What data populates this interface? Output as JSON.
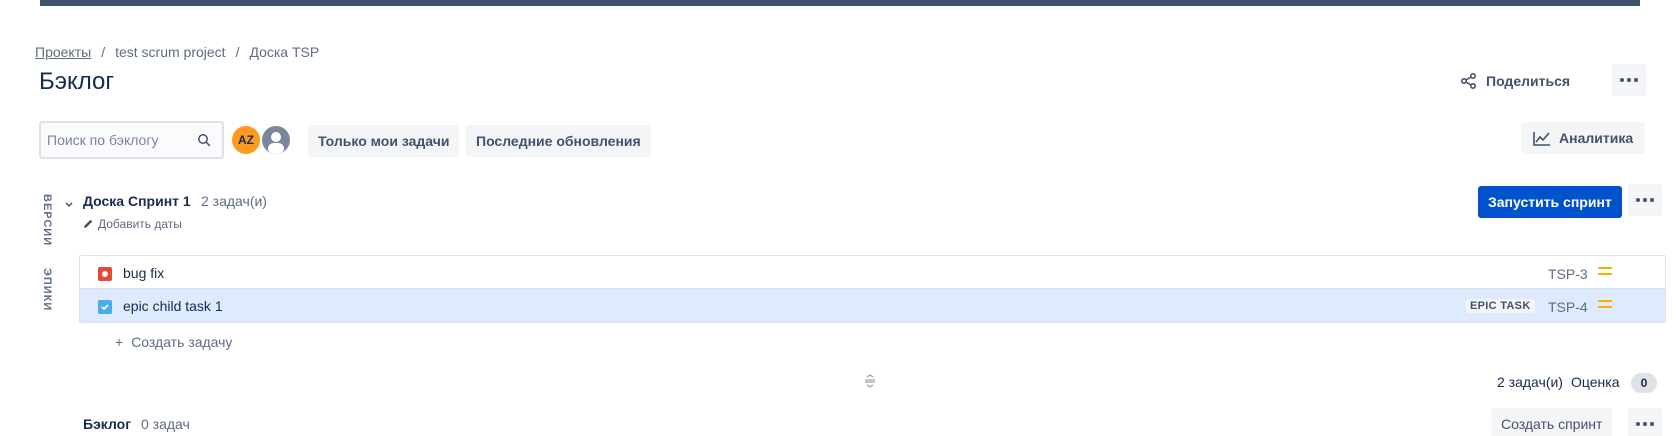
{
  "breadcrumb": {
    "items": [
      "Проекты",
      "test scrum project",
      "Доска TSP"
    ],
    "separator": "/"
  },
  "page": {
    "title": "Бэклог"
  },
  "header": {
    "share_label": "Поделиться"
  },
  "toolbar": {
    "search_placeholder": "Поиск по бэклогу",
    "avatar_initials": "AZ",
    "filter_mine": "Только мои задачи",
    "filter_recent": "Последние обновления",
    "analytics_label": "Аналитика"
  },
  "side_tabs": {
    "versions": "ВЕРСИИ",
    "epics": "ЭПИКИ"
  },
  "sprint": {
    "name": "Доска Спринт 1",
    "count": "2 задач(и)",
    "add_dates": "Добавить даты",
    "start_label": "Запустить спринт",
    "issues": [
      {
        "type": "bug",
        "summary": "bug fix",
        "epic": "",
        "key": "TSP-3",
        "priority": "medium"
      },
      {
        "type": "task",
        "summary": "epic child task 1",
        "epic": "EPIC TASK",
        "key": "TSP-4",
        "priority": "medium"
      }
    ],
    "create_issue": "Создать задачу",
    "create_issue_plus": "+",
    "footer_count": "2 задач(и)",
    "footer_estimate_label": "Оценка",
    "footer_estimate_value": "0"
  },
  "backlog": {
    "name": "Бэклог",
    "count": "0 задач",
    "create_sprint": "Создать спринт"
  },
  "colors": {
    "primary": "#0052cc",
    "bug": "#e5493a",
    "task": "#4bade8",
    "priority_medium": "#ffab00",
    "selected_row": "#deebff",
    "avatar": "#ff991f"
  }
}
